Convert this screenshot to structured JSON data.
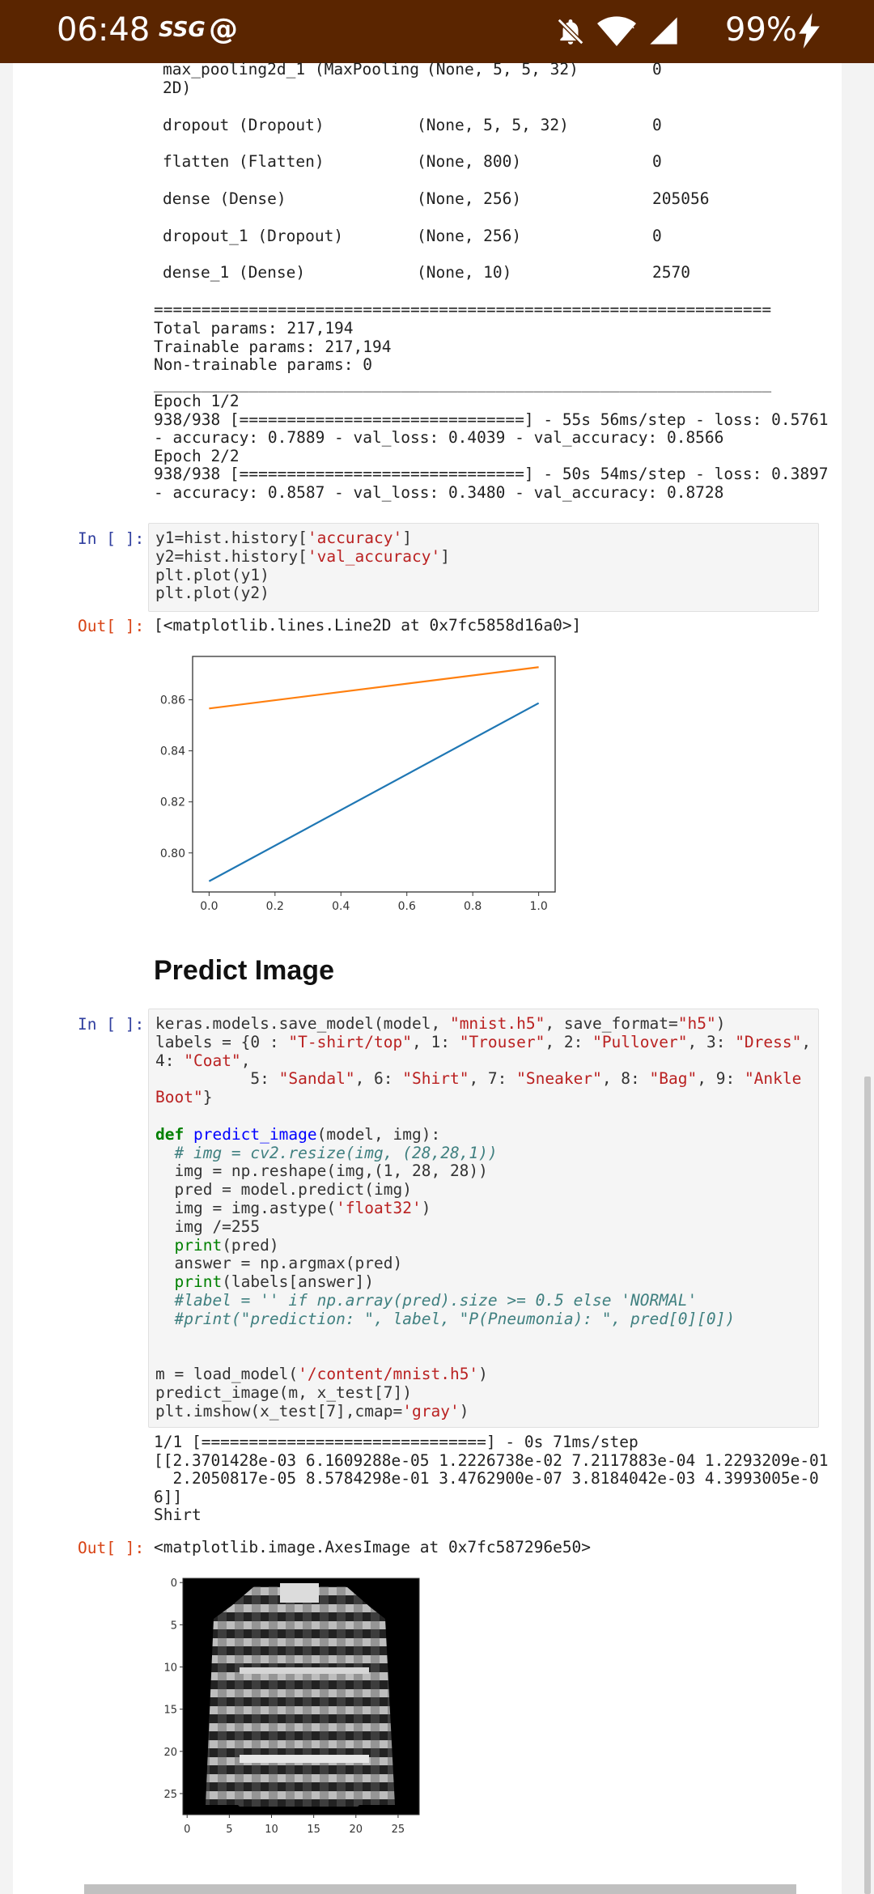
{
  "status_bar": {
    "time": "06:48",
    "carrier": "SSG",
    "battery": "99%"
  },
  "model_summary": {
    "layers": [
      {
        "name": "max_pooling2d_1 (MaxPooling",
        "name2": "2D)",
        "shape": "(None, 5, 5, 32)",
        "params": "0"
      },
      {
        "name": "dropout (Dropout)",
        "shape": "(None, 5, 5, 32)",
        "params": "0"
      },
      {
        "name": "flatten (Flatten)",
        "shape": "(None, 800)",
        "params": "0"
      },
      {
        "name": "dense (Dense)",
        "shape": "(None, 256)",
        "params": "205056"
      },
      {
        "name": "dropout_1 (Dropout)",
        "shape": "(None, 256)",
        "params": "0"
      },
      {
        "name": "dense_1 (Dense)",
        "shape": "(None, 10)",
        "params": "2570"
      }
    ],
    "separator": "=================================================================",
    "totals": "Total params: 217,194\nTrainable params: 217,194\nNon-trainable params: 0",
    "rule": "_________________________________________________________________",
    "training_log": "Epoch 1/2\n938/938 [==============================] - 55s 56ms/step - loss: 0.5761\n- accuracy: 0.7889 - val_loss: 0.4039 - val_accuracy: 0.8566\nEpoch 2/2\n938/938 [==============================] - 50s 54ms/step - loss: 0.3897\n- accuracy: 0.8587 - val_loss: 0.3480 - val_accuracy: 0.8728"
  },
  "cell_plot": {
    "in_prompt": "In [ ]:",
    "out_prompt": "Out[ ]:",
    "output_repr": "[<matplotlib.lines.Line2D at 0x7fc5858d16a0>]"
  },
  "chart_data": {
    "type": "line",
    "x": [
      0.0,
      1.0
    ],
    "series": [
      {
        "values": [
          0.7889,
          0.8587
        ],
        "color": "#1f77b4"
      },
      {
        "values": [
          0.8566,
          0.8728
        ],
        "color": "#ff7f0e"
      }
    ],
    "xticks": [
      "0.0",
      "0.2",
      "0.4",
      "0.6",
      "0.8",
      "1.0"
    ],
    "yticks": [
      "0.80",
      "0.82",
      "0.84",
      "0.86"
    ],
    "xlim": [
      -0.05,
      1.05
    ],
    "ylim": [
      0.7847,
      0.877
    ],
    "grid": false
  },
  "predict_section": {
    "heading": "Predict Image"
  },
  "cell_predict": {
    "in_prompt": "In [ ]:",
    "out_prompt": "Out[ ]:",
    "stdout": "1/1 [==============================] - 0s 71ms/step\n[[2.3701428e-03 6.1609288e-05 1.2226738e-02 7.2117883e-04 1.2293209e-01\n  2.2050817e-05 8.5784298e-01 3.4762900e-07 3.8184042e-03 4.3993005e-0\n6]]\nShirt",
    "output_repr": "<matplotlib.image.AxesImage at 0x7fc587296e50>"
  },
  "image_axes": {
    "xticks": [
      "0",
      "5",
      "10",
      "15",
      "20",
      "25"
    ],
    "yticks": [
      "0",
      "5",
      "10",
      "15",
      "20",
      "25"
    ],
    "colormap": "gray"
  }
}
